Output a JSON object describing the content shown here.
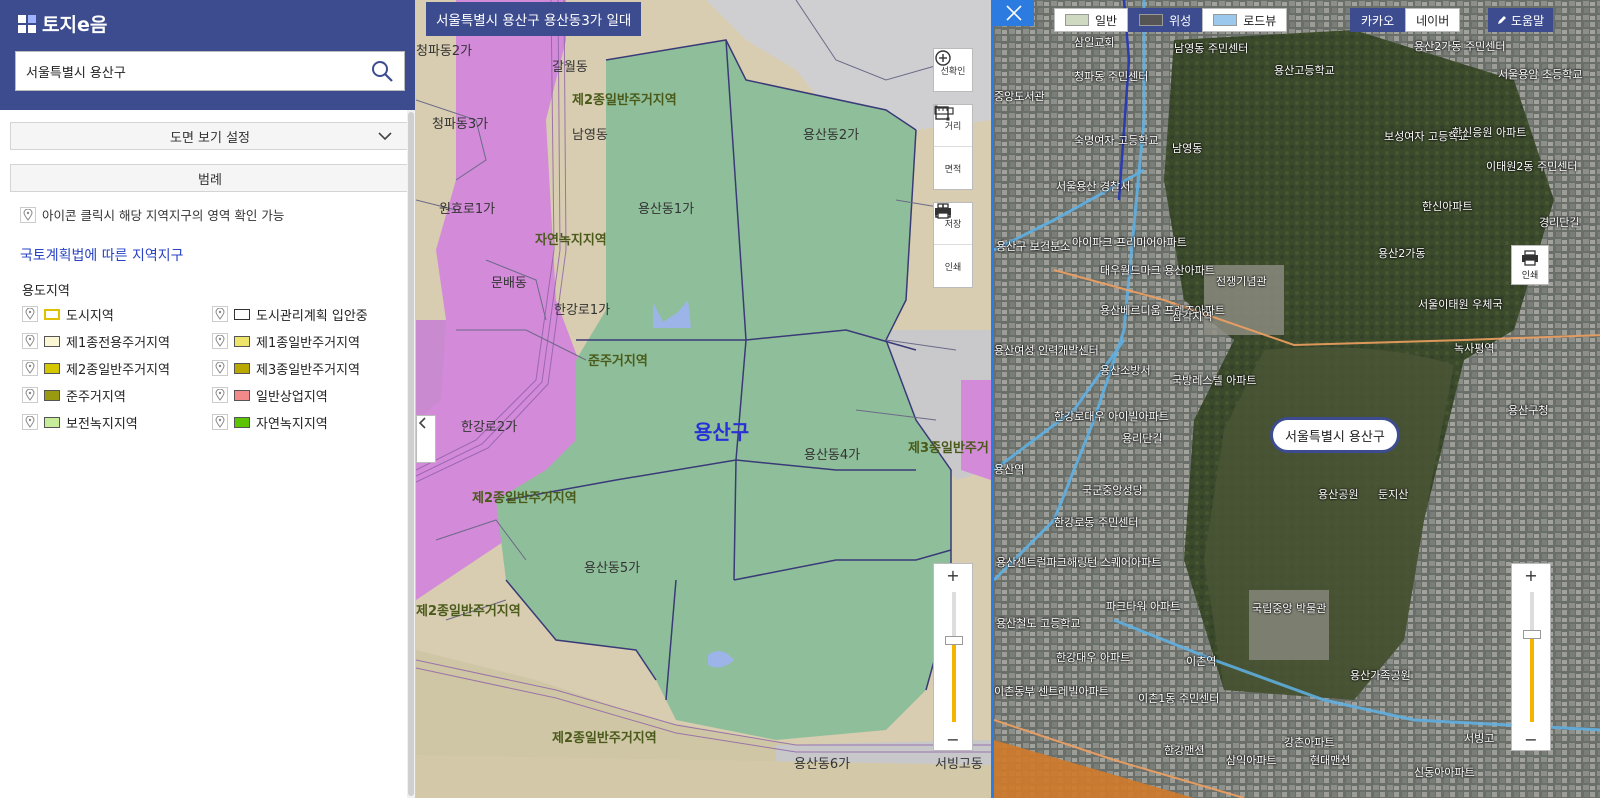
{
  "app": {
    "logo_text": "토지e음"
  },
  "search": {
    "value": "서울특별시 용산구"
  },
  "panel": {
    "view_settings_label": "도면 보기 설정",
    "legend_label": "범례",
    "hint_text": "아이콘 클릭시 해당 지역지구의 영역 확인 가능",
    "section_title": "국토계획법에 따른 지역지구",
    "subsection_title": "용도지역",
    "legend_items": [
      {
        "label": "도시지역",
        "fill": "#ffffff",
        "border": "#e0c000"
      },
      {
        "label": "도시관리계획 입안중",
        "fill": "#ffffff",
        "border": "#333333"
      },
      {
        "label": "제1종전용주거지역",
        "fill": "#fbf7d4",
        "border": "#555555"
      },
      {
        "label": "제1종일반주거지역",
        "fill": "#efe46a",
        "border": "#555555"
      },
      {
        "label": "제2종일반주거지역",
        "fill": "#d4c700",
        "border": "#555555"
      },
      {
        "label": "제3종일반주거지역",
        "fill": "#b8a800",
        "border": "#555555"
      },
      {
        "label": "준주거지역",
        "fill": "#9a9a10",
        "border": "#555555"
      },
      {
        "label": "일반상업지역",
        "fill": "#f28a8a",
        "border": "#555555"
      },
      {
        "label": "보전녹지지역",
        "fill": "#c7ec9a",
        "border": "#555555"
      },
      {
        "label": "자연녹지지역",
        "fill": "#5cc400",
        "border": "#555555"
      }
    ]
  },
  "mapA": {
    "location_badge": "서울특별시 용산구 용산동3가 일대",
    "district_label": "용산구",
    "labels": [
      {
        "t": "청파동2가"
      },
      {
        "t": "갈월동"
      },
      {
        "t": "제2종일반주거지역"
      },
      {
        "t": "청파동3가"
      },
      {
        "t": "남영동"
      },
      {
        "t": "용산동2가"
      },
      {
        "t": "원효로1가"
      },
      {
        "t": "용산동1가"
      },
      {
        "t": "자연녹지지역"
      },
      {
        "t": "문배동"
      },
      {
        "t": "한강로1가"
      },
      {
        "t": "준주거지역"
      },
      {
        "t": "한강로2가"
      },
      {
        "t": "용산동4가"
      },
      {
        "t": "제3종일반주거"
      },
      {
        "t": "제2종일반주거지역"
      },
      {
        "t": "용산동5가"
      },
      {
        "t": "제2종일반주거지역"
      },
      {
        "t": "제2종일반주거지역"
      },
      {
        "t": "용산동6가"
      },
      {
        "t": "서빙고동"
      }
    ],
    "tools": [
      "선확인",
      "거리",
      "면적",
      "저장",
      "인쇄"
    ]
  },
  "mapB": {
    "map_types": [
      "일반",
      "위성",
      "로드뷰"
    ],
    "providers": [
      "카카오",
      "네이버"
    ],
    "help_label": "도움말",
    "callout": "서울특별시 용산구",
    "print_label": "인쇄",
    "labels": [
      "삼일교회",
      "남영동 주민센터",
      "용산고등학교",
      "용산2가동 주민센터",
      "서울용암 초등학교",
      "청파동 주민센터",
      "중앙도서관",
      "숙명여자 고등학교",
      "남영동",
      "보성여자 고등학교",
      "한신응원 아파트",
      "서울용산 경찰서",
      "이태원2동 주민센터",
      "아이파크 프리미어아파트",
      "한신아파트",
      "경리단길",
      "대우월드마크 용산아파트",
      "전쟁기념관",
      "용산구 보건분소",
      "용산2가동",
      "용산베르디움 프렌즈아파트",
      "삼각지역",
      "서울이태원 우체국",
      "용산소방서",
      "녹사평역",
      "국방레스텔 아파트",
      "용산여성 인력개발센터",
      "한강로대우 아이빌아파트",
      "용산구청",
      "용리단길",
      "용산역",
      "국군중앙성당",
      "용산공원",
      "둔지산",
      "한강로동 주민센터",
      "용산센트럴파크해링턴 스퀘어아파트",
      "파크타워 아파트",
      "국립중앙 박물관",
      "용산철도 고등학교",
      "한강대우 아파트",
      "이촌역",
      "용산가족공원",
      "이촌동부 센트레빌아파트",
      "이촌1동 주민센터",
      "한강맨션",
      "삼익아파트",
      "강촌아파트",
      "현대맨션",
      "신동아아파트",
      "서빙고"
    ]
  },
  "colors": {
    "brand": "#3d4c8f",
    "accent": "#2c7be0",
    "green_zone": "#8fbf9a",
    "pink_zone": "#d38ad8"
  }
}
